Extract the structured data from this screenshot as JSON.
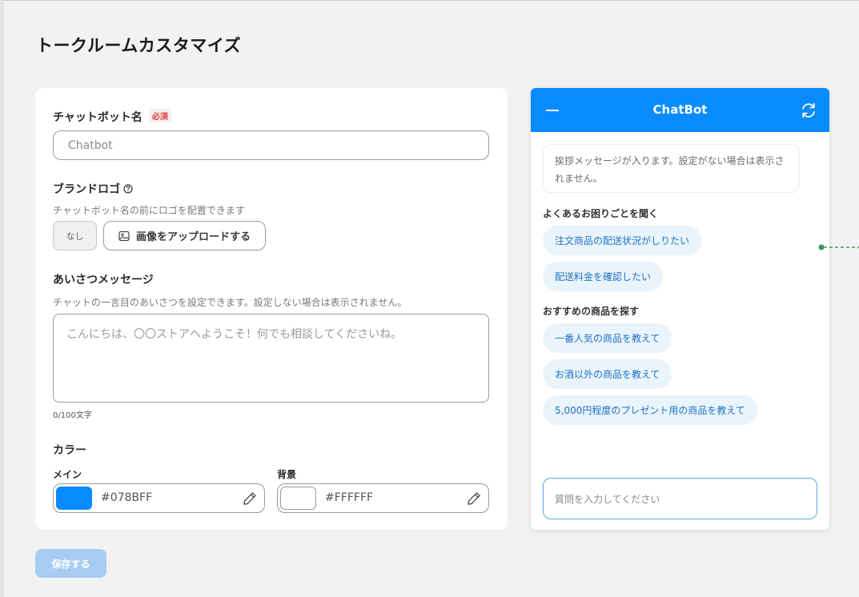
{
  "page": {
    "title": "トークルームカスタマイズ"
  },
  "form": {
    "bot_name": {
      "label": "チャットボット名",
      "required_badge": "必須",
      "value": "Chatbot"
    },
    "brand_logo": {
      "label": "ブランドロゴ",
      "help_icon": "question-circle-icon",
      "description": "チャットボット名の前にロゴを配置できます",
      "none_label": "なし",
      "upload_label": "画像をアップロードする",
      "upload_icon": "image-icon"
    },
    "greeting": {
      "label": "あいさつメッセージ",
      "description": "チャットの一言目のあいさつを設定できます。設定しない場合は表示されません。",
      "placeholder": "こんにちは、〇〇ストアへようこそ！何でも相談してくださいね。",
      "counter": "0/100文字"
    },
    "color": {
      "label": "カラー",
      "main": {
        "label": "メイン",
        "value": "#078BFF",
        "swatch": "#078bff"
      },
      "background": {
        "label": "背景",
        "value": "#FFFFFF",
        "swatch": "#ffffff"
      },
      "edit_icon": "pencil-icon"
    },
    "save_label": "保存する"
  },
  "preview": {
    "header": {
      "title": "ChatBot",
      "minimize_icon": "minimize-icon",
      "refresh_icon": "refresh-icon",
      "color": "#078bff"
    },
    "greeting_bubble": "挨拶メッセージが入ります。設定がない場合は表示されません。",
    "sections": [
      {
        "label": "よくあるお困りごとを聞く",
        "chips": [
          "注文商品の配送状況がしりたい",
          "配送料金を確認したい"
        ]
      },
      {
        "label": "おすすめの商品を探す",
        "chips": [
          "一番人気の商品を教えて",
          "お酒以外の商品を教えて",
          "5,000円程度のプレゼント用の商品を教えて"
        ]
      }
    ],
    "input_placeholder": "質問を入力してください"
  }
}
